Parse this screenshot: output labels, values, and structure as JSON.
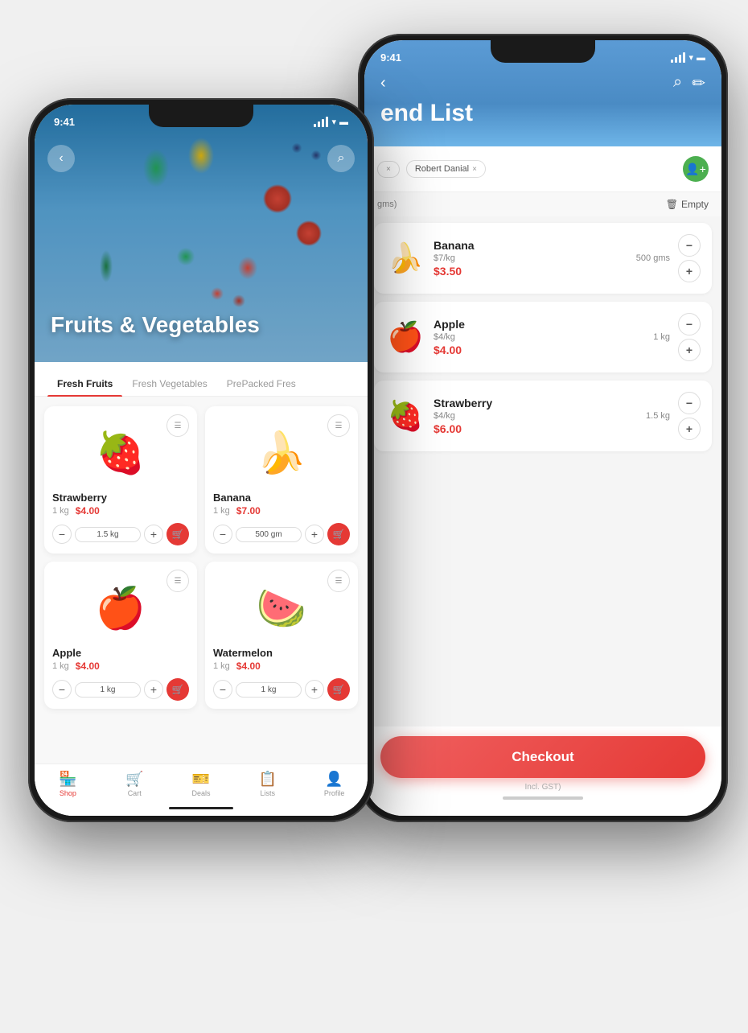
{
  "phone1": {
    "status": {
      "time": "9:41",
      "signal": "▪▪▪▪",
      "wifi": "WiFi",
      "battery": "Batt"
    },
    "hero": {
      "title": "Fruits & Vegetables"
    },
    "tabs": [
      {
        "label": "Fresh Fruits",
        "active": true
      },
      {
        "label": "Fresh Vegetables",
        "active": false
      },
      {
        "label": "PrePacked Fres",
        "active": false
      }
    ],
    "products": [
      {
        "name": "Strawberry",
        "weight": "1 kg",
        "price": "$4.00",
        "qty": "1.5 kg",
        "emoji": "🍓"
      },
      {
        "name": "Banana",
        "weight": "1 kg",
        "price": "$7.00",
        "qty": "500 gm",
        "emoji": "🍌"
      },
      {
        "name": "Apple",
        "weight": "1 kg",
        "price": "$4.00",
        "qty": "1 kg",
        "emoji": "🍎"
      },
      {
        "name": "Watermelon",
        "weight": "1 kg",
        "price": "$4.00",
        "qty": "1 kg",
        "emoji": "🍉"
      }
    ],
    "nav": [
      {
        "label": "Shop",
        "icon": "🏪",
        "active": true
      },
      {
        "label": "Cart",
        "icon": "🛒",
        "active": false
      },
      {
        "label": "Deals",
        "icon": "🎫",
        "active": false
      },
      {
        "label": "Lists",
        "icon": "📋",
        "active": false
      },
      {
        "label": "Profile",
        "icon": "👤",
        "active": false
      }
    ]
  },
  "phone2": {
    "status": {
      "time": "9:41"
    },
    "header": {
      "title": "end List",
      "back_icon": "‹",
      "search_icon": "⌕",
      "edit_icon": "✏"
    },
    "tags": [
      {
        "label": "×"
      },
      {
        "label": "Robert Danial",
        "has_close": true
      }
    ],
    "section": {
      "label": "gms)",
      "empty_label": "Empty"
    },
    "cart_items": [
      {
        "name": "Banana",
        "rate": "$7/kg",
        "qty_text": "500 gms",
        "price": "$3.50",
        "emoji": "🍌"
      },
      {
        "name": "Apple",
        "rate": "$4/kg",
        "qty_text": "1 kg",
        "price": "$4.00",
        "emoji": "🍎"
      },
      {
        "name": "Strawberry",
        "rate": "$4/kg",
        "qty_text": "1.5 kg",
        "price": "$6.00",
        "emoji": "🍓"
      }
    ],
    "footer": {
      "checkout_label": "Checkout",
      "note": "Incl. GST)"
    }
  }
}
